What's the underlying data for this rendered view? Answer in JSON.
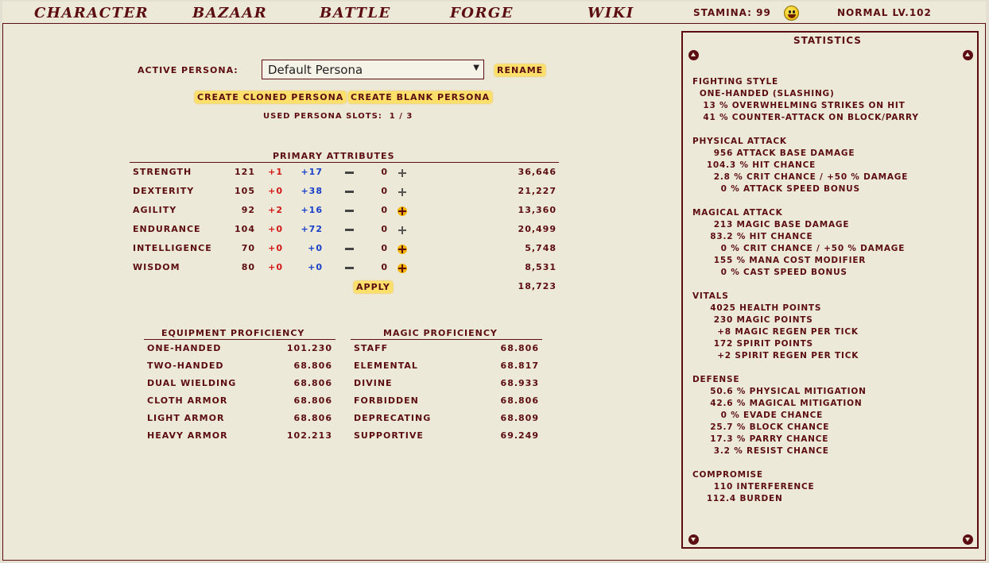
{
  "nav": {
    "character": "CHARACTER",
    "bazaar": "BAZAAR",
    "battle": "BATTLE",
    "forge": "FORGE",
    "wiki": "WIKI"
  },
  "top": {
    "stamina": "STAMINA: 99",
    "level": "NORMAL LV.102"
  },
  "persona": {
    "label": "ACTIVE PERSONA:",
    "selected": "Default Persona",
    "rename": "RENAME",
    "create_cloned": "CREATE CLONED PERSONA",
    "create_blank": "CREATE BLANK PERSONA",
    "slots": "USED PERSONA SLOTS:  1 / 3"
  },
  "primary": {
    "title": "PRIMARY ATTRIBUTES",
    "rows": [
      {
        "name": "STRENGTH",
        "base": "121",
        "mod1": "+1",
        "mod2": "+17",
        "alloc": "0",
        "cost": "36,646"
      },
      {
        "name": "DEXTERITY",
        "base": "105",
        "mod1": "+0",
        "mod2": "+38",
        "alloc": "0",
        "cost": "21,227"
      },
      {
        "name": "AGILITY",
        "base": "92",
        "mod1": "+2",
        "mod2": "+16",
        "alloc": "0",
        "cost": "13,360"
      },
      {
        "name": "ENDURANCE",
        "base": "104",
        "mod1": "+0",
        "mod2": "+72",
        "alloc": "0",
        "cost": "20,499"
      },
      {
        "name": "INTELLIGENCE",
        "base": "70",
        "mod1": "+0",
        "mod2": "+0",
        "alloc": "0",
        "cost": "5,748"
      },
      {
        "name": "WISDOM",
        "base": "80",
        "mod1": "+0",
        "mod2": "+0",
        "alloc": "0",
        "cost": "8,531"
      }
    ],
    "apply": "APPLY",
    "total": "18,723"
  },
  "equipment": {
    "title": "EQUIPMENT PROFICIENCY",
    "rows": [
      {
        "name": "ONE-HANDED",
        "value": "101.230"
      },
      {
        "name": "TWO-HANDED",
        "value": "68.806"
      },
      {
        "name": "DUAL WIELDING",
        "value": "68.806"
      },
      {
        "name": "CLOTH ARMOR",
        "value": "68.806"
      },
      {
        "name": "LIGHT ARMOR",
        "value": "68.806"
      },
      {
        "name": "HEAVY ARMOR",
        "value": "102.213"
      }
    ]
  },
  "magic": {
    "title": "MAGIC PROFICIENCY",
    "rows": [
      {
        "name": "STAFF",
        "value": "68.806"
      },
      {
        "name": "ELEMENTAL",
        "value": "68.817"
      },
      {
        "name": "DIVINE",
        "value": "68.933"
      },
      {
        "name": "FORBIDDEN",
        "value": "68.806"
      },
      {
        "name": "DEPRECATING",
        "value": "68.809"
      },
      {
        "name": "SUPPORTIVE",
        "value": "69.249"
      }
    ]
  },
  "statistics": {
    "title": "STATISTICS",
    "lines": [
      "FIGHTING STYLE",
      "  ONE-HANDED (SLASHING)",
      "   13 % OVERWHELMING STRIKES ON HIT",
      "   41 % COUNTER-ATTACK ON BLOCK/PARRY",
      "",
      "PHYSICAL ATTACK",
      "      956 ATTACK BASE DAMAGE",
      "    104.3 % HIT CHANCE",
      "      2.8 % CRIT CHANCE / +50 % DAMAGE",
      "        0 % ATTACK SPEED BONUS",
      "",
      "MAGICAL ATTACK",
      "      213 MAGIC BASE DAMAGE",
      "     83.2 % HIT CHANCE",
      "        0 % CRIT CHANCE / +50 % DAMAGE",
      "      155 % MANA COST MODIFIER",
      "        0 % CAST SPEED BONUS",
      "",
      "VITALS",
      "     4025 HEALTH POINTS",
      "      230 MAGIC POINTS",
      "       +8 MAGIC REGEN PER TICK",
      "      172 SPIRIT POINTS",
      "       +2 SPIRIT REGEN PER TICK",
      "",
      "DEFENSE",
      "     50.6 % PHYSICAL MITIGATION",
      "     42.6 % MAGICAL MITIGATION",
      "        0 % EVADE CHANCE",
      "     25.7 % BLOCK CHANCE",
      "     17.3 % PARRY CHANCE",
      "      3.2 % RESIST CHANCE",
      "",
      "COMPROMISE",
      "      110 INTERFERENCE",
      "    112.4 BURDEN"
    ]
  },
  "colors": {
    "maroon": "#5c0d12",
    "background": "#ede9d8",
    "button_yellow": "#fde06a",
    "positive_red": "#d01818",
    "positive_blue": "#1840c8"
  }
}
